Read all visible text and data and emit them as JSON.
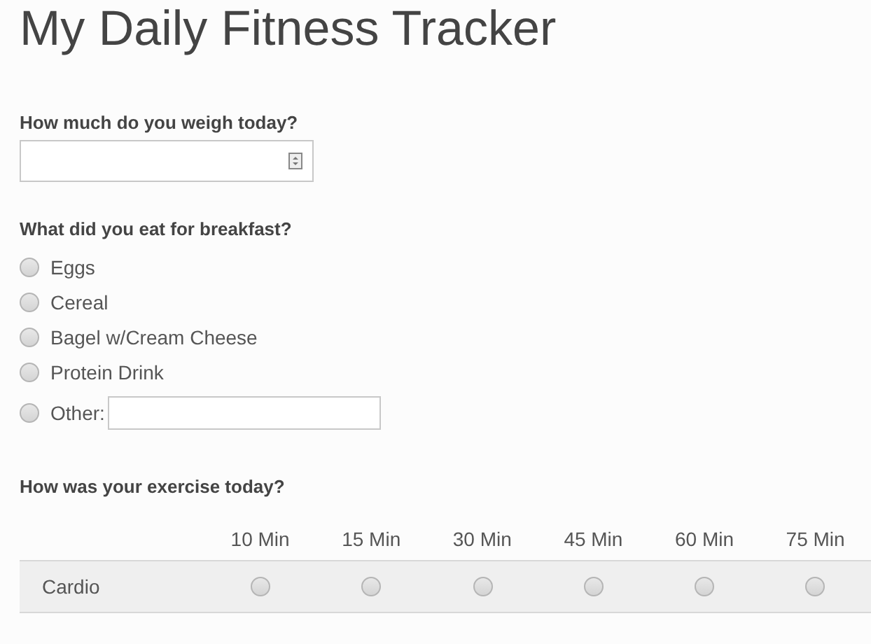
{
  "title": "My Daily Fitness Tracker",
  "weight": {
    "question": "How much do you weigh today?"
  },
  "breakfast": {
    "question": "What did you eat for breakfast?",
    "options": [
      {
        "label": "Eggs",
        "selected": false,
        "kind": "plain"
      },
      {
        "label": "Cereal",
        "selected": false,
        "kind": "plain"
      },
      {
        "label": "Bagel w/Cream Cheese",
        "selected": false,
        "kind": "plain"
      },
      {
        "label": "Protein Drink",
        "selected": false,
        "kind": "plain"
      },
      {
        "label": "Other:",
        "selected": false,
        "kind": "other"
      }
    ]
  },
  "exercise": {
    "question": "How was your exercise today?",
    "columns": [
      "10 Min",
      "15 Min",
      "30 Min",
      "45 Min",
      "60 Min",
      "75 Min"
    ],
    "rows": [
      {
        "label": "Cardio",
        "choices": [
          {
            "selected": false
          },
          {
            "selected": false
          },
          {
            "selected": false
          },
          {
            "selected": false
          },
          {
            "selected": false
          },
          {
            "selected": false
          }
        ]
      }
    ]
  }
}
